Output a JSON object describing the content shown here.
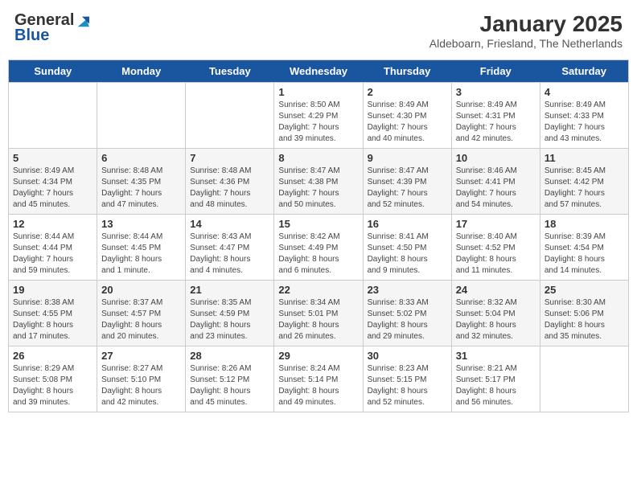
{
  "header": {
    "logo_general": "General",
    "logo_blue": "Blue",
    "month_title": "January 2025",
    "location": "Aldeboarn, Friesland, The Netherlands"
  },
  "days_of_week": [
    "Sunday",
    "Monday",
    "Tuesday",
    "Wednesday",
    "Thursday",
    "Friday",
    "Saturday"
  ],
  "weeks": [
    [
      {
        "day": "",
        "info": ""
      },
      {
        "day": "",
        "info": ""
      },
      {
        "day": "",
        "info": ""
      },
      {
        "day": "1",
        "info": "Sunrise: 8:50 AM\nSunset: 4:29 PM\nDaylight: 7 hours\nand 39 minutes."
      },
      {
        "day": "2",
        "info": "Sunrise: 8:49 AM\nSunset: 4:30 PM\nDaylight: 7 hours\nand 40 minutes."
      },
      {
        "day": "3",
        "info": "Sunrise: 8:49 AM\nSunset: 4:31 PM\nDaylight: 7 hours\nand 42 minutes."
      },
      {
        "day": "4",
        "info": "Sunrise: 8:49 AM\nSunset: 4:33 PM\nDaylight: 7 hours\nand 43 minutes."
      }
    ],
    [
      {
        "day": "5",
        "info": "Sunrise: 8:49 AM\nSunset: 4:34 PM\nDaylight: 7 hours\nand 45 minutes."
      },
      {
        "day": "6",
        "info": "Sunrise: 8:48 AM\nSunset: 4:35 PM\nDaylight: 7 hours\nand 47 minutes."
      },
      {
        "day": "7",
        "info": "Sunrise: 8:48 AM\nSunset: 4:36 PM\nDaylight: 7 hours\nand 48 minutes."
      },
      {
        "day": "8",
        "info": "Sunrise: 8:47 AM\nSunset: 4:38 PM\nDaylight: 7 hours\nand 50 minutes."
      },
      {
        "day": "9",
        "info": "Sunrise: 8:47 AM\nSunset: 4:39 PM\nDaylight: 7 hours\nand 52 minutes."
      },
      {
        "day": "10",
        "info": "Sunrise: 8:46 AM\nSunset: 4:41 PM\nDaylight: 7 hours\nand 54 minutes."
      },
      {
        "day": "11",
        "info": "Sunrise: 8:45 AM\nSunset: 4:42 PM\nDaylight: 7 hours\nand 57 minutes."
      }
    ],
    [
      {
        "day": "12",
        "info": "Sunrise: 8:44 AM\nSunset: 4:44 PM\nDaylight: 7 hours\nand 59 minutes."
      },
      {
        "day": "13",
        "info": "Sunrise: 8:44 AM\nSunset: 4:45 PM\nDaylight: 8 hours\nand 1 minute."
      },
      {
        "day": "14",
        "info": "Sunrise: 8:43 AM\nSunset: 4:47 PM\nDaylight: 8 hours\nand 4 minutes."
      },
      {
        "day": "15",
        "info": "Sunrise: 8:42 AM\nSunset: 4:49 PM\nDaylight: 8 hours\nand 6 minutes."
      },
      {
        "day": "16",
        "info": "Sunrise: 8:41 AM\nSunset: 4:50 PM\nDaylight: 8 hours\nand 9 minutes."
      },
      {
        "day": "17",
        "info": "Sunrise: 8:40 AM\nSunset: 4:52 PM\nDaylight: 8 hours\nand 11 minutes."
      },
      {
        "day": "18",
        "info": "Sunrise: 8:39 AM\nSunset: 4:54 PM\nDaylight: 8 hours\nand 14 minutes."
      }
    ],
    [
      {
        "day": "19",
        "info": "Sunrise: 8:38 AM\nSunset: 4:55 PM\nDaylight: 8 hours\nand 17 minutes."
      },
      {
        "day": "20",
        "info": "Sunrise: 8:37 AM\nSunset: 4:57 PM\nDaylight: 8 hours\nand 20 minutes."
      },
      {
        "day": "21",
        "info": "Sunrise: 8:35 AM\nSunset: 4:59 PM\nDaylight: 8 hours\nand 23 minutes."
      },
      {
        "day": "22",
        "info": "Sunrise: 8:34 AM\nSunset: 5:01 PM\nDaylight: 8 hours\nand 26 minutes."
      },
      {
        "day": "23",
        "info": "Sunrise: 8:33 AM\nSunset: 5:02 PM\nDaylight: 8 hours\nand 29 minutes."
      },
      {
        "day": "24",
        "info": "Sunrise: 8:32 AM\nSunset: 5:04 PM\nDaylight: 8 hours\nand 32 minutes."
      },
      {
        "day": "25",
        "info": "Sunrise: 8:30 AM\nSunset: 5:06 PM\nDaylight: 8 hours\nand 35 minutes."
      }
    ],
    [
      {
        "day": "26",
        "info": "Sunrise: 8:29 AM\nSunset: 5:08 PM\nDaylight: 8 hours\nand 39 minutes."
      },
      {
        "day": "27",
        "info": "Sunrise: 8:27 AM\nSunset: 5:10 PM\nDaylight: 8 hours\nand 42 minutes."
      },
      {
        "day": "28",
        "info": "Sunrise: 8:26 AM\nSunset: 5:12 PM\nDaylight: 8 hours\nand 45 minutes."
      },
      {
        "day": "29",
        "info": "Sunrise: 8:24 AM\nSunset: 5:14 PM\nDaylight: 8 hours\nand 49 minutes."
      },
      {
        "day": "30",
        "info": "Sunrise: 8:23 AM\nSunset: 5:15 PM\nDaylight: 8 hours\nand 52 minutes."
      },
      {
        "day": "31",
        "info": "Sunrise: 8:21 AM\nSunset: 5:17 PM\nDaylight: 8 hours\nand 56 minutes."
      },
      {
        "day": "",
        "info": ""
      }
    ]
  ]
}
